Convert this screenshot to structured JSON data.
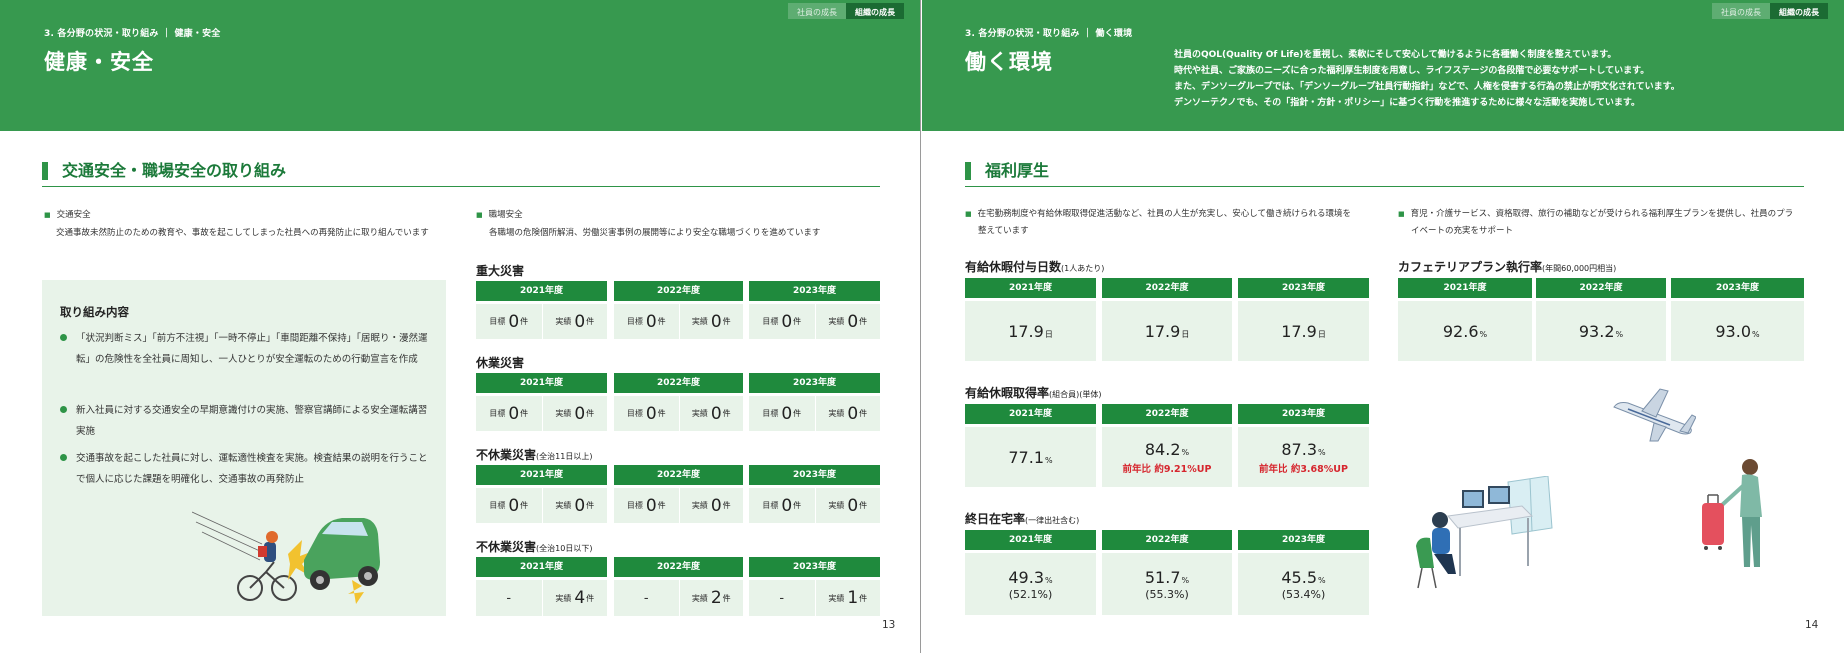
{
  "tabs": {
    "employee_growth": "社員の成長",
    "org_growth": "組織の成長"
  },
  "left": {
    "breadcrumb": "3. 各分野の状況・取り組み ｜ 健康・安全",
    "title": "健康・安全",
    "section_title": "交通安全・職場安全の取り組み",
    "traffic_label": "交通安全",
    "traffic_text": "交通事故未然防止のための教育や、事故を起こしてしまった社員への再発防止に取り組んでいます",
    "workplace_label": "職場安全",
    "workplace_text": "各職場の危険個所解消、労働災害事例の展開等により安全な職場づくりを進めています",
    "box_title": "取り組み内容",
    "box_items": [
      "「状況判断ミス」「前方不注視」「一時不停止」「車間距離不保持」「居眠り・漫然運転」の危険性を全社員に周知し、一人ひとりが安全運転のための行動宣言を作成",
      "新入社員に対する交通安全の早期意識付けの実施、警察官講師による安全運転講習実施",
      "交通事故を起こした社員に対し、運転適性検査を実施。検査結果の説明を行うことで個人に応じた課題を明確化し、交通事故の再発防止"
    ],
    "years": [
      "2021年度",
      "2022年度",
      "2023年度"
    ],
    "target_label": "目標",
    "actual_label": "実績",
    "count_unit": "件",
    "serious_title": "重大災害",
    "serious": [
      {
        "target": "0",
        "actual": "0"
      },
      {
        "target": "0",
        "actual": "0"
      },
      {
        "target": "0",
        "actual": "0"
      }
    ],
    "lost_time_title": "休業災害",
    "lost_time": [
      {
        "target": "0",
        "actual": "0"
      },
      {
        "target": "0",
        "actual": "0"
      },
      {
        "target": "0",
        "actual": "0"
      }
    ],
    "non_lost11_title": "不休業災害",
    "non_lost11_note": "(全治11日以上)",
    "non_lost11": [
      {
        "target": "0",
        "actual": "0"
      },
      {
        "target": "0",
        "actual": "0"
      },
      {
        "target": "0",
        "actual": "0"
      }
    ],
    "non_lost10_title": "不休業災害",
    "non_lost10_note": "(全治10日以下)",
    "non_lost10": [
      {
        "target": "-",
        "actual": "4"
      },
      {
        "target": "-",
        "actual": "2"
      },
      {
        "target": "-",
        "actual": "1"
      }
    ],
    "page_number": "13"
  },
  "right": {
    "breadcrumb": "3. 各分野の状況・取り組み ｜ 働く環境",
    "title": "働く環境",
    "intro": [
      "社員のQOL(Quality Of Life)を重視し、柔軟にそして安心して働けるように各種働く制度を整えています。",
      "時代や社員、ご家族のニーズに合った福利厚生制度を用意し、ライフステージの各段階で必要なサポートしています。",
      "また、デンソーグループでは、「デンソーグループ社員行動指針」などで、人権を侵害する行為の禁止が明文化されています。",
      "デンソーテクノでも、その「指針・方針・ポリシー」に基づく行動を推進するために様々な活動を実施しています。"
    ],
    "section_title": "福利厚生",
    "bullet1": [
      "在宅勤務制度や有給休暇取得促進活動など、社員の人生が充実し、安心して働き続けられる環境を",
      "整えています"
    ],
    "bullet2": [
      "育児・介護サービス、資格取得、旅行の補助などが受けられる福利厚生プランを提供し、社員のプラ",
      "イベートの充実をサポート"
    ],
    "years": [
      "2021年度",
      "2022年度",
      "2023年度"
    ],
    "paid_days_title": "有給休暇付与日数",
    "paid_days_note": "(1人あたり)",
    "paid_days_unit": "日",
    "paid_days": [
      "17.9",
      "17.9",
      "17.9"
    ],
    "cafeteria_title": "カフェテリアプラン執行率",
    "cafeteria_note": "(年間60,000円相当)",
    "percent_unit": "%",
    "cafeteria": [
      "92.6",
      "93.2",
      "93.0"
    ],
    "paid_rate_title": "有給休暇取得率",
    "paid_rate_note": "(組合員)(単体)",
    "paid_rate": [
      "77.1",
      "84.2",
      "87.3"
    ],
    "paid_rate_notes": [
      "",
      "前年比 約9.21%UP",
      "前年比 約3.68%UP"
    ],
    "remote_title": "終日在宅率",
    "remote_note": "(一律出社含む)",
    "remote": [
      "49.3",
      "51.7",
      "45.5"
    ],
    "remote_sub": [
      "(52.1%)",
      "(55.3%)",
      "(53.4%)"
    ],
    "page_number": "14"
  }
}
